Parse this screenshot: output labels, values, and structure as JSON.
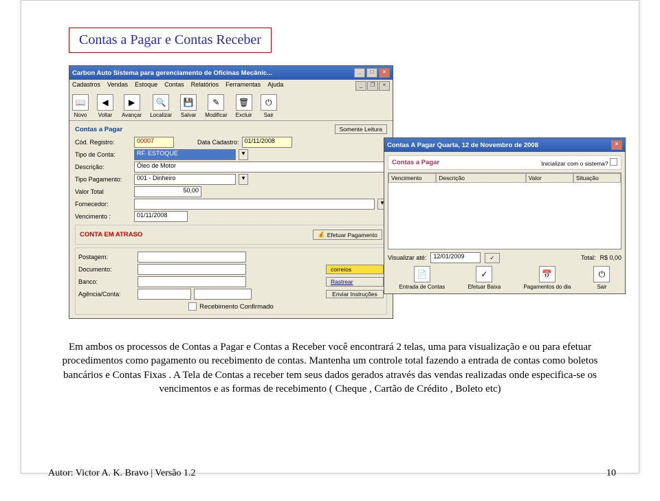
{
  "title_box": "Contas a Pagar e Contas Receber",
  "win1": {
    "title": "Carbon Auto   Sistema para gerenciamento de Oficinas Mecânic...",
    "menus": [
      "Cadastros",
      "Vendas",
      "Estoque",
      "Contas",
      "Relatórios",
      "Ferramentas",
      "Ajuda"
    ],
    "toolbar": {
      "novo": "Novo",
      "voltar": "Voltar",
      "avancar": "Avançar",
      "localizar": "Localizar",
      "salvar": "Salvar",
      "modificar": "Modificar",
      "excluir": "Excluir",
      "sair": "Sair"
    },
    "form_title": "Contas a Pagar",
    "btn_somente_leitura": "Somente Leitura",
    "fields": {
      "cod_registro_lbl": "Cód. Registro:",
      "cod_registro_val": "00007",
      "data_cadastro_lbl": "Data Cadastro:",
      "data_cadastro_val": "01/11/2008",
      "tipo_conta_lbl": "Tipo de Conta:",
      "tipo_conta_val": "RF. ESTOQUE",
      "descricao_lbl": "Descrição:",
      "descricao_val": "Óleo de Motor",
      "tipo_pag_lbl": "Tipo Pagamento:",
      "tipo_pag_val": "001 - Dinheiro",
      "valor_lbl": "Valor Total",
      "valor_val": "50,00",
      "forn_lbl": "Fornecedor:",
      "forn_val": "",
      "venc_lbl": "Vencimento :",
      "venc_val": "01/11/2008"
    },
    "atraso": "CONTA EM ATRASO",
    "btn_efetuar": "Efetuar Pagamento",
    "post_lbl": "Postagem:",
    "doc_lbl": "Documento:",
    "banco_lbl": "Banco:",
    "agconta_lbl": "Agência/Conta:",
    "btn_correios": "correios",
    "btn_rastrear": "Rastrear",
    "btn_enviar": "Enviar Instruções",
    "chk_recebimento": "Recebimento Confirmado"
  },
  "win2": {
    "title": "Contas A Pagar   Quarta, 12 de Novembro de 2008",
    "panel_title": "Contas a Pagar",
    "chk_inicializar": "Inicializar com o sistema?",
    "cols": [
      "Vencimento",
      "Descrição",
      "Valor",
      "Situação"
    ],
    "visualizar_lbl": "Visualizar até:",
    "visualizar_val": "12/01/2009",
    "total_lbl": "Total:",
    "total_val": "R$ 0,00",
    "btns": {
      "entrada": "Entrada de Contas",
      "baixa": "Efetuar Baixa",
      "pagdia": "Pagamentos do dia",
      "sair": "Sair"
    }
  },
  "body": {
    "p1": "Em ambos os processos de Contas a Pagar e Contas a Receber você encontrará 2 telas, uma para visualização e ou para efetuar procedimentos como pagamento ou recebimento de contas. Mantenha um controle total fazendo a entrada de contas como boletos bancários e Contas Fixas . A Tela de Contas a receber tem seus dados gerados através das vendas realizadas onde especifica-se os vencimentos e as formas de recebimento ( Cheque , Cartão de Crédito , Boleto etc)"
  },
  "footer": "Autor: Victor A. K. Bravo  | Versão 1.2",
  "pagenum": "10"
}
